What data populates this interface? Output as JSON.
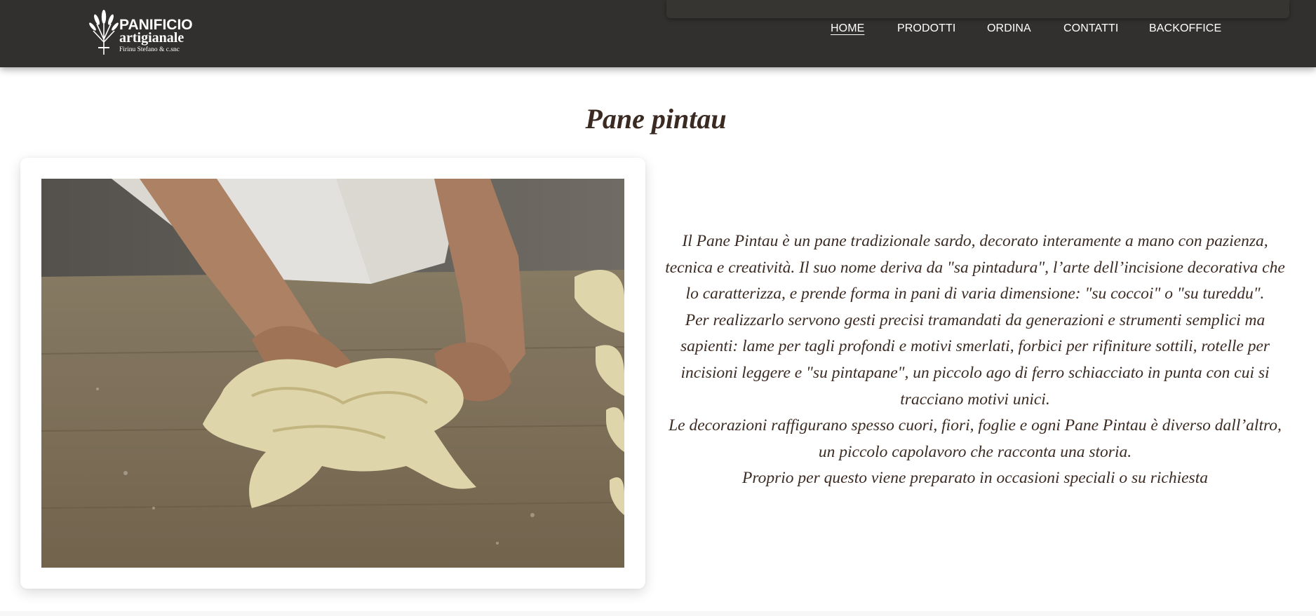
{
  "brand": {
    "line1": "PANIFICIO",
    "line2": "artigianale",
    "line3": "Firinu Stefano & c.snc",
    "logo_icon": "wheat-sheaf-icon"
  },
  "nav": {
    "items": [
      {
        "label": "HOME",
        "active": true
      },
      {
        "label": "PRODOTTI",
        "active": false
      },
      {
        "label": "ORDINA",
        "active": false
      },
      {
        "label": "CONTATTI",
        "active": false
      },
      {
        "label": "BACKOFFICE",
        "active": false
      }
    ]
  },
  "page": {
    "title": "Pane pintau"
  },
  "description": {
    "paragraphs": [
      "Il Pane Pintau è un pane tradizionale sardo, decorato interamente a mano con pazienza, tecnica e creatività. Il suo nome deriva da \"sa pintadura\", l’arte dell’incisione decorativa che lo caratterizza, e prende forma in pani di varia dimensione: \"su coccoi\" o \"su tureddu\".",
      "Per realizzarlo servono gesti precisi tramandati da generazioni e strumenti semplici ma sapienti: lame per tagli profondi e motivi smerlati, forbici per rifiniture sottili, rotelle per incisioni leggere e \"su pintapane\", un piccolo ago di ferro schiacciato in punta con cui si tracciano motivi unici.",
      "Le decorazioni raffigurano spesso cuori, fiori, foglie e ogni Pane Pintau è diverso dall’altro, un piccolo capolavoro che racconta una storia.",
      "Proprio per questo viene preparato in occasioni speciali o su richiesta"
    ]
  },
  "colors": {
    "navbar": "#31302e",
    "title": "#3a2a22",
    "text": "#3c2b22",
    "background": "#ffffff"
  }
}
